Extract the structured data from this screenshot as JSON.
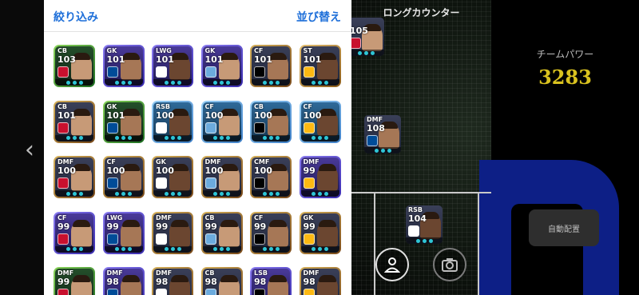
{
  "panel": {
    "filter_label": "絞り込み",
    "sort_label": "並び替え"
  },
  "formation": {
    "label": "ロングカウンター"
  },
  "team_power": {
    "label": "チームパワー",
    "value": "3283"
  },
  "auto_button": {
    "label": "自動配置"
  },
  "colors": {
    "accent": "#1e6fd9",
    "team_power": "#d9c21f",
    "pitch_blue": "#0d1f86"
  },
  "icons": {
    "profile": "person-icon",
    "camera": "camera-icon",
    "back": "chevron-left-icon"
  },
  "players": [
    {
      "pos": "CB",
      "ovr": "103",
      "type": "bigtime"
    },
    {
      "pos": "GK",
      "ovr": "101",
      "type": "showtime"
    },
    {
      "pos": "LWG",
      "ovr": "101",
      "type": "showtime"
    },
    {
      "pos": "GK",
      "ovr": "101",
      "type": "showtime"
    },
    {
      "pos": "CF",
      "ovr": "101",
      "type": "epic"
    },
    {
      "pos": "ST",
      "ovr": "101",
      "type": "legend"
    },
    {
      "pos": "CB",
      "ovr": "101",
      "type": "epic"
    },
    {
      "pos": "GK",
      "ovr": "101",
      "type": "bigtime"
    },
    {
      "pos": "RSB",
      "ovr": "100",
      "type": "potw"
    },
    {
      "pos": "CF",
      "ovr": "100",
      "type": "potw"
    },
    {
      "pos": "CB",
      "ovr": "100",
      "type": "potw"
    },
    {
      "pos": "CF",
      "ovr": "100",
      "type": "potw"
    },
    {
      "pos": "DMF",
      "ovr": "100",
      "type": "epic"
    },
    {
      "pos": "CF",
      "ovr": "100",
      "type": "epic"
    },
    {
      "pos": "GK",
      "ovr": "100",
      "type": "epic"
    },
    {
      "pos": "DMF",
      "ovr": "100",
      "type": "epic"
    },
    {
      "pos": "CMF",
      "ovr": "100",
      "type": "epic"
    },
    {
      "pos": "DMF",
      "ovr": "99",
      "type": "showtime"
    },
    {
      "pos": "CF",
      "ovr": "99",
      "type": "showtime"
    },
    {
      "pos": "LWG",
      "ovr": "99",
      "type": "showtime"
    },
    {
      "pos": "DMF",
      "ovr": "99",
      "type": "epic"
    },
    {
      "pos": "CB",
      "ovr": "99",
      "type": "epic"
    },
    {
      "pos": "CF",
      "ovr": "99",
      "type": "epic"
    },
    {
      "pos": "GK",
      "ovr": "99",
      "type": "epic"
    },
    {
      "pos": "DMF",
      "ovr": "99",
      "type": "bigtime"
    },
    {
      "pos": "DMF",
      "ovr": "98",
      "type": "showtime"
    },
    {
      "pos": "DMF",
      "ovr": "98",
      "type": "epic"
    },
    {
      "pos": "CB",
      "ovr": "98",
      "type": "epic"
    },
    {
      "pos": "LSB",
      "ovr": "98",
      "type": "showtime"
    },
    {
      "pos": "DMF",
      "ovr": "98",
      "type": "epic"
    }
  ],
  "pitch_players": [
    {
      "pos": "",
      "ovr": "105",
      "type": "showtime"
    },
    {
      "pos": "DMF",
      "ovr": "108",
      "type": "epic"
    },
    {
      "pos": "RSB",
      "ovr": "104",
      "type": "legend"
    }
  ]
}
